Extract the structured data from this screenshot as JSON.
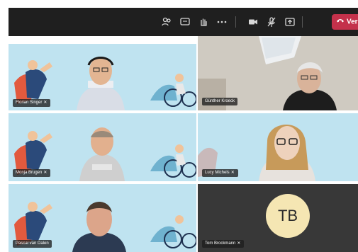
{
  "toolbar": {
    "leave_label": "Verla",
    "icons": [
      "people-icon",
      "chat-icon",
      "raise-hand-icon",
      "more-icon",
      "camera-icon",
      "mic-muted-icon",
      "share-icon",
      "phone-icon"
    ]
  },
  "participants": [
    {
      "name": "Florian Singer",
      "muted": true
    },
    {
      "name": "Günther Kroeck",
      "muted": false
    },
    {
      "name": "Monja Brugen",
      "muted": true
    },
    {
      "name": "Lucy Michels",
      "muted": true
    },
    {
      "name": "Pascal van Dalen",
      "muted": false
    },
    {
      "name": "Tom Brockmann",
      "muted": true,
      "initials": "TB"
    }
  ],
  "colors": {
    "leave": "#c4314b",
    "toolbar": "#1f1f1f",
    "tile_bg": "#bfe3f0",
    "avatar": "#f5e6b3"
  }
}
